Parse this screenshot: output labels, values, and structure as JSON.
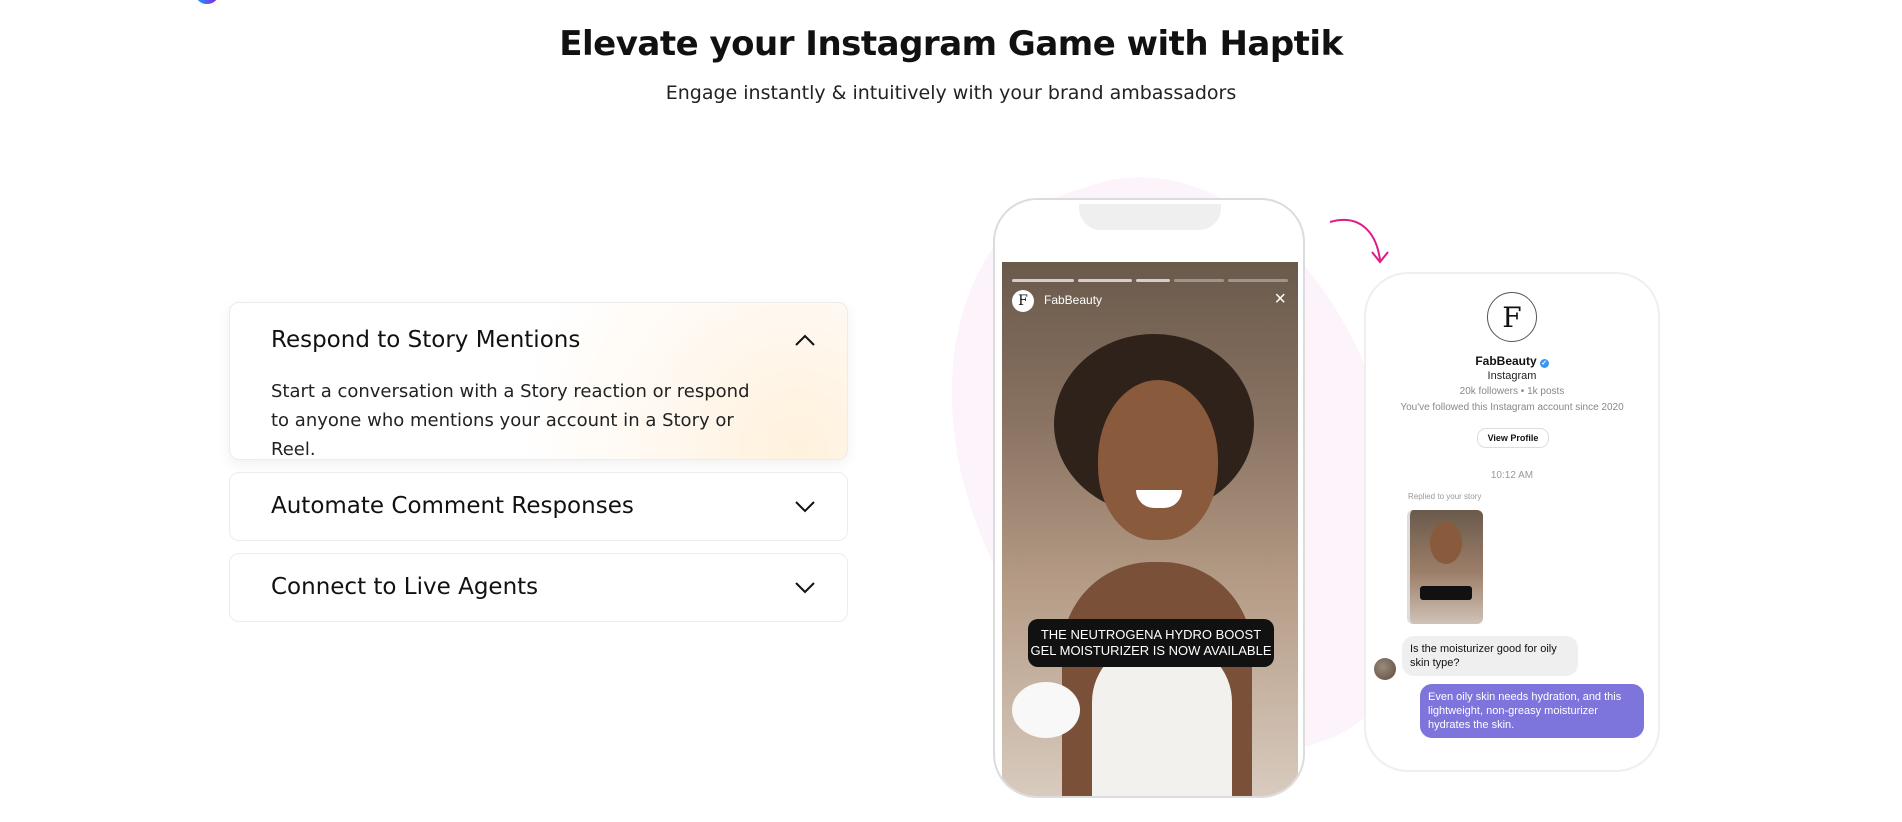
{
  "header": {
    "title": "Elevate your Instagram Game with Haptik",
    "subtitle": "Engage instantly & intuitively with your brand ambassadors"
  },
  "accordion": {
    "items": [
      {
        "title": "Respond to Story Mentions",
        "body": "Start a conversation with a Story reaction or respond to anyone who mentions your account in a Story or Reel.",
        "expanded": true
      },
      {
        "title": "Automate Comment Responses",
        "expanded": false
      },
      {
        "title": "Connect to Live Agents",
        "expanded": false
      }
    ]
  },
  "story_phone": {
    "username": "FabBeauty",
    "avatar_letter": "F",
    "close_icon": "×",
    "caption": "THE NEUTROGENA HYDRO BOOST GEL MOISTURIZER IS NOW AVAILABLE"
  },
  "dm_phone": {
    "avatar_letter": "F",
    "name": "FabBeauty",
    "verified_mark": "✓",
    "platform": "Instagram",
    "stats": "20k followers • 1k posts",
    "since": "You've followed this Instagram account since 2020",
    "view_profile": "View Profile",
    "time": "10:12 AM",
    "replied_label": "Replied to your story",
    "incoming_message": "Is the moisturizer good for oily skin type?",
    "outgoing_message": "Even oily skin needs hydration, and this lightweight, non-greasy moisturizer hydrates the skin."
  },
  "colors": {
    "accent_pink": "#e0198a",
    "bubble_purple": "#7d74dc",
    "verified_blue": "#3897f0"
  }
}
